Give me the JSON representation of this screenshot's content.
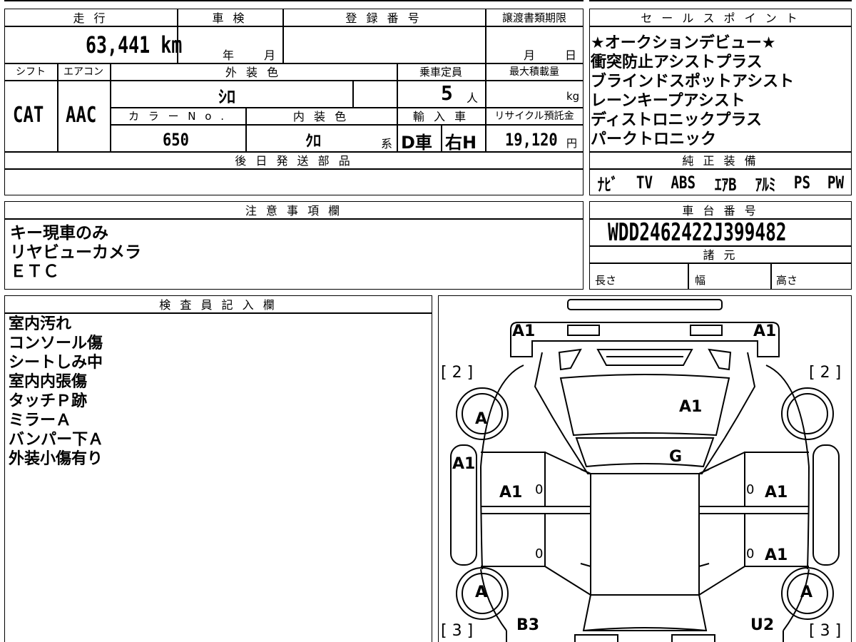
{
  "top_table": {
    "mileage_header": "走 行",
    "mileage_value": "63,441 km",
    "shaken_header": "車 検",
    "shaken_year_unit": "年",
    "shaken_month_unit": "月",
    "registration_header": "登 録 番 号",
    "transfer_deadline_header": "譲渡書類期限",
    "transfer_month_unit": "月",
    "transfer_day_unit": "日",
    "shift_header": "シフト",
    "shift_value": "CAT",
    "aircon_header": "エアコン",
    "aircon_value": "AAC",
    "exterior_color_header": "外 装 色",
    "exterior_color_value": "ｼﾛ",
    "capacity_header": "乗車定員",
    "capacity_value": "5",
    "capacity_unit": "人",
    "max_load_header": "最大積載量",
    "max_load_unit": "kg",
    "color_no_header": "カ ラ ー N o .",
    "color_no_value": "650",
    "interior_color_header": "内 装 色",
    "interior_color_value": "ｸﾛ",
    "interior_color_suffix": "系",
    "import_header": "輸 入 車",
    "import_value_1": "D車",
    "import_value_2": "右H",
    "recycle_header": "リサイクル預託金",
    "recycle_value": "19,120",
    "recycle_unit": "円",
    "later_parts_header": "後 日 発 送 部 品"
  },
  "sales_points": {
    "header": "セ ー ル ス ポ イ ン ト",
    "items": [
      "★オークションデビュー★",
      "衝突防止アシストプラス",
      "ブラインドスポットアシスト",
      "レーンキープアシスト",
      "ディストロニックプラス",
      "パークトロニック"
    ]
  },
  "genuine_equipment": {
    "header": "純 正 装 備",
    "items": [
      "ﾅﾋﾞ",
      "TV",
      "ABS",
      "ｴｱB",
      "ｱﾙﾐ",
      "PS",
      "PW"
    ]
  },
  "notes": {
    "header": "注 意 事 項 欄",
    "items": [
      "キー現車のみ",
      "リヤビューカメラ",
      "ＥＴＣ"
    ]
  },
  "chassis": {
    "header": "車 台 番 号",
    "value": "WDD2462422J399482",
    "specs_header": "諸 元",
    "length_label": "長さ",
    "width_label": "幅",
    "height_label": "高さ"
  },
  "inspector": {
    "header": "検 査 員 記 入 欄",
    "items": [
      "室内汚れ",
      "コンソール傷",
      "シートしみ中",
      "室内内張傷",
      "タッチＰ跡",
      "ミラーＡ",
      "バンパー下Ａ",
      "外装小傷有り"
    ]
  },
  "diagram": {
    "front_left": "A1",
    "front_right": "A1",
    "tire_front_left_bracket": "[ 2 ]",
    "tire_front_right_bracket": "[ 2 ]",
    "tire_front_left": "A",
    "hood": "A1",
    "windshield": "G",
    "left_fender": "A1",
    "front_left_door": "A1",
    "front_left_door_sub": "0",
    "front_right_door_sub": "0",
    "front_right_door": "A1",
    "rear_left_door_sub": "0",
    "rear_right_door_sub": "0",
    "rear_right_door": "A1",
    "tire_rear_left": "A",
    "tire_rear_right": "A",
    "rear_left": "B3",
    "rear_right": "U2",
    "tire_rear_left_bracket": "[ 3 ]",
    "tire_rear_right_bracket": "[ 3 ]"
  }
}
